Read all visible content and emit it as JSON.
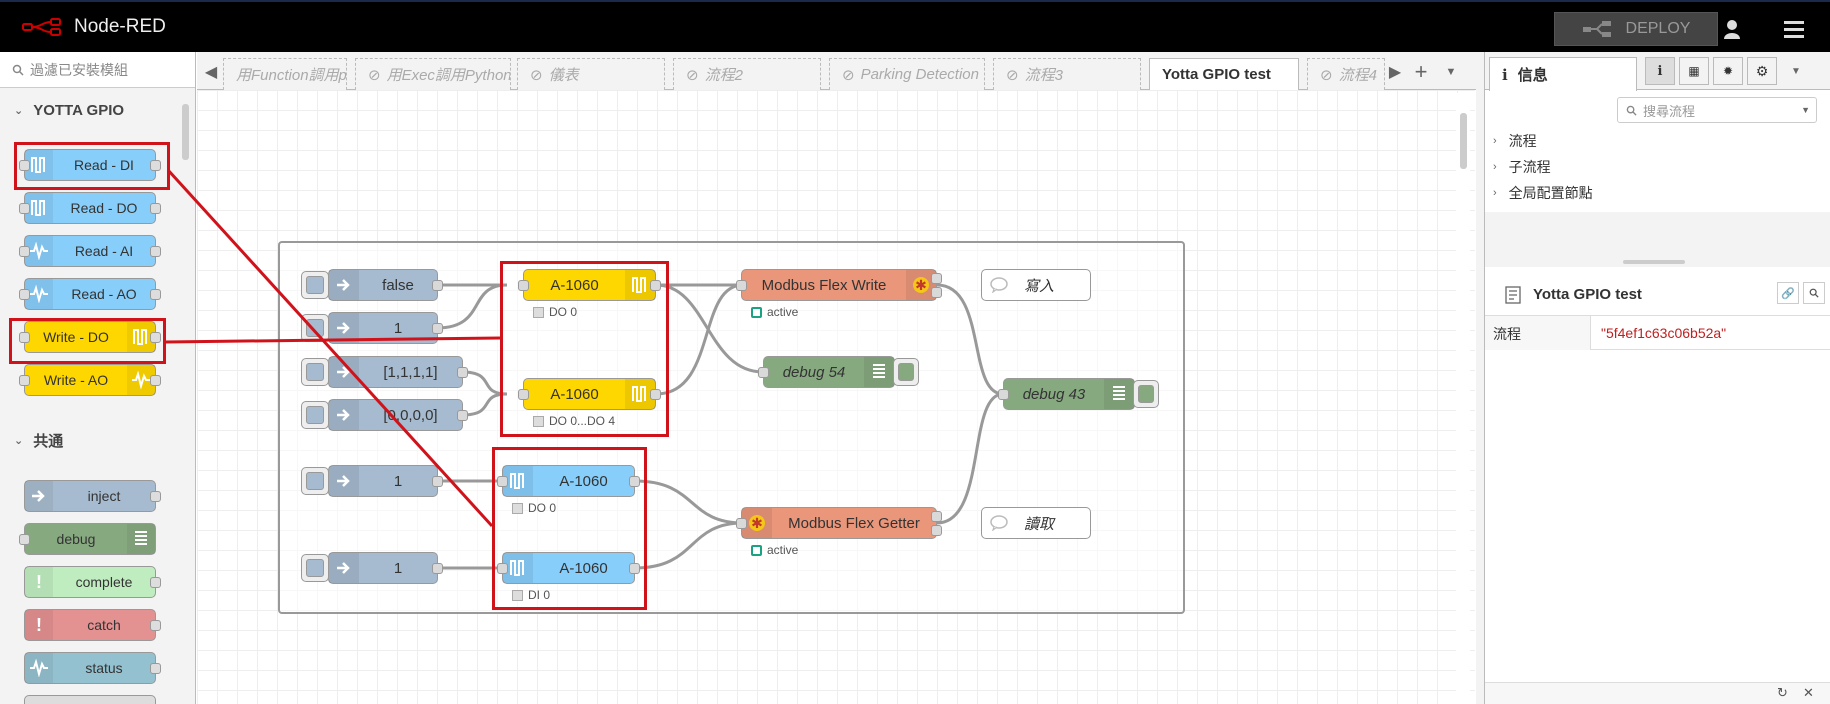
{
  "app": {
    "title": "Node-RED",
    "deploy_label": "DEPLOY"
  },
  "palette": {
    "filter_placeholder": "過濾已安裝模組",
    "categories": [
      {
        "label": "YOTTA GPIO"
      },
      {
        "label": "共通"
      }
    ],
    "gpio_nodes": [
      {
        "label": "Read - DI",
        "color": "#87CEFA"
      },
      {
        "label": "Read - DO",
        "color": "#87CEFA"
      },
      {
        "label": "Read - AI",
        "color": "#87CEFA"
      },
      {
        "label": "Read - AO",
        "color": "#87CEFA"
      },
      {
        "label": "Write - DO",
        "color": "#FFD700"
      },
      {
        "label": "Write - AO",
        "color": "#FFD700"
      }
    ],
    "common_nodes": [
      {
        "label": "inject",
        "color": "#a6bbcf"
      },
      {
        "label": "debug",
        "color": "#87a980"
      },
      {
        "label": "complete",
        "color": "#c0edc0"
      },
      {
        "label": "catch",
        "color": "#e49191"
      },
      {
        "label": "status",
        "color": "#94c1d0"
      }
    ]
  },
  "tabs": [
    {
      "label": "用Function調用py"
    },
    {
      "label": "用Exec調用Python"
    },
    {
      "label": "儀表"
    },
    {
      "label": "流程2"
    },
    {
      "label": "Parking Detection"
    },
    {
      "label": "流程3"
    },
    {
      "label": "Yotta GPIO test",
      "active": true
    },
    {
      "label": "流程4"
    }
  ],
  "flow": {
    "injects": [
      {
        "label": "false"
      },
      {
        "label": "1"
      },
      {
        "label": "[1,1,1,1]"
      },
      {
        "label": "[0,0,0,0]"
      },
      {
        "label": "1"
      },
      {
        "label": "1"
      }
    ],
    "gpio": [
      {
        "label": "A-1060",
        "status": "DO 0"
      },
      {
        "label": "A-1060",
        "status": "DO 0...DO 4"
      },
      {
        "label": "A-1060",
        "status": "DO 0"
      },
      {
        "label": "A-1060",
        "status": "DI 0"
      }
    ],
    "modbus_write": {
      "label": "Modbus Flex Write",
      "status": "active"
    },
    "modbus_getter": {
      "label": "Modbus Flex Getter",
      "status": "active"
    },
    "debug54": {
      "label": "debug 54"
    },
    "debug43": {
      "label": "debug 43"
    },
    "comment_write": {
      "label": "寫入"
    },
    "comment_read": {
      "label": "讀取"
    }
  },
  "sidebar": {
    "tab_label": "信息",
    "search_placeholder": "搜尋流程",
    "tree": [
      {
        "label": "流程"
      },
      {
        "label": "子流程"
      },
      {
        "label": "全局配置節點"
      }
    ],
    "info_title": "Yotta GPIO test",
    "prop_key": "流程",
    "prop_value": "\"5f4ef1c63c06b52a\""
  },
  "colors": {
    "header_bg": "#000000",
    "highlight_red": "#d0131b",
    "modbus_orange": "#e9967a",
    "gpio_yellow": "#FFD700",
    "gpio_blue": "#87CEFA"
  }
}
